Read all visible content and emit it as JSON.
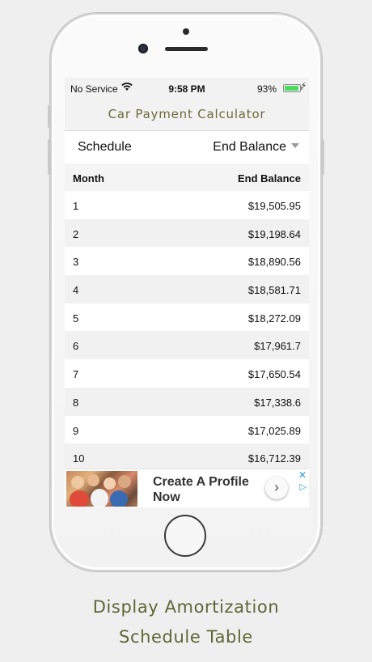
{
  "status_bar": {
    "carrier": "No Service",
    "time": "9:58 PM",
    "battery_percent": "93%",
    "battery_level": 0.93,
    "battery_color": "#4cd964"
  },
  "nav": {
    "title": "Car Payment Calculator",
    "title_color": "#6b6b3a"
  },
  "schedule": {
    "label": "Schedule",
    "selected_option": "End Balance"
  },
  "table": {
    "headers": {
      "month": "Month",
      "balance": "End Balance"
    },
    "rows": [
      {
        "month": "1",
        "balance": "$19,505.95"
      },
      {
        "month": "2",
        "balance": "$19,198.64"
      },
      {
        "month": "3",
        "balance": "$18,890.56"
      },
      {
        "month": "4",
        "balance": "$18,581.71"
      },
      {
        "month": "5",
        "balance": "$18,272.09"
      },
      {
        "month": "6",
        "balance": "$17,961.7"
      },
      {
        "month": "7",
        "balance": "$17,650.54"
      },
      {
        "month": "8",
        "balance": "$17,338.6"
      },
      {
        "month": "9",
        "balance": "$17,025.89"
      },
      {
        "month": "10",
        "balance": "$16,712.39"
      }
    ]
  },
  "ad": {
    "headline": "Create A Profile Now",
    "chevron_icon": "chevron-right-icon",
    "close_icon": "close-icon",
    "choices_icon": "ad-choices-icon"
  },
  "caption": {
    "line1": "Display Amortization",
    "line2": "Schedule Table",
    "color": "#606638"
  }
}
